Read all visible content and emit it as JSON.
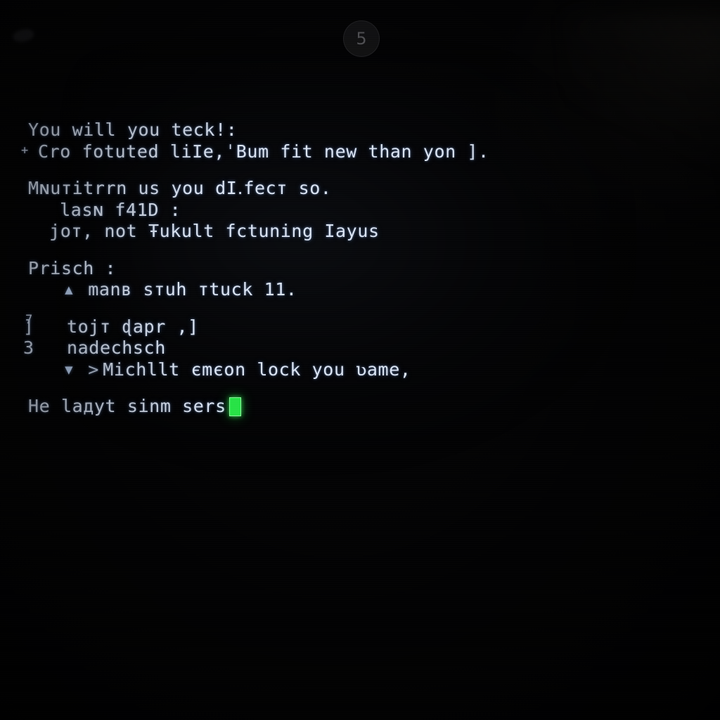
{
  "screen": {
    "background_color": "#030304",
    "text_color": "#dbe4f3",
    "cursor_color": "#27e246"
  },
  "badge": {
    "name": "top-center-badge",
    "label": "5"
  },
  "terminal": {
    "blocks": [
      {
        "lines": [
          {
            "indent": 0,
            "text": "You will you teck!:"
          },
          {
            "indent": 0,
            "superscript": "+",
            "text": "Cro fotuted liІe,ˈBum fit new than yon ]."
          }
        ]
      },
      {
        "lines": [
          {
            "indent": 0,
            "text": "Mɴuтitrrn us you dІ․fecт so."
          },
          {
            "indent": 3,
            "text": "lasɴ f41D :"
          },
          {
            "indent": 2,
            "text": "joт, not Ŧukult fctuning Іayuѕ"
          }
        ]
      },
      {
        "lines": [
          {
            "indent": 0,
            "text": "Prisch :"
          },
          {
            "indent": 2,
            "marker": "▲",
            "text": "manв sтuh тtuck 11."
          }
        ]
      },
      {
        "lines": [
          {
            "gutter": "]",
            "superscript": "7",
            "indent": 0,
            "text": "tojт ɖapr ,]"
          },
          {
            "gutter": "3",
            "indent": 0,
            "text": "nadechsch"
          },
          {
            "indent": 2,
            "marker": "▼",
            "prompt": ">",
            "text": "Michllt єmєon lock you ʋame,"
          }
        ]
      },
      {
        "lines": [
          {
            "indent": 0,
            "negative": true,
            "text": "He lадуt ѕinm sers",
            "cursor": true
          }
        ]
      }
    ]
  }
}
